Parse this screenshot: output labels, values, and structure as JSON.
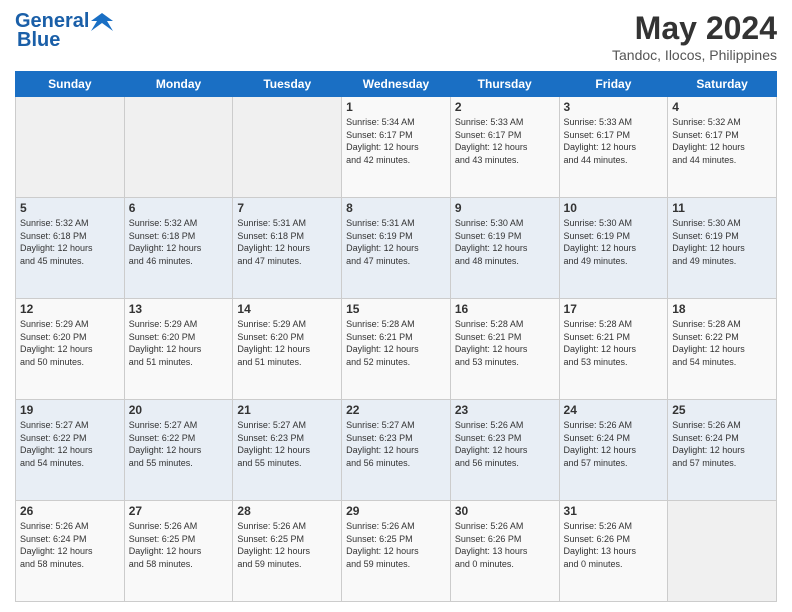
{
  "header": {
    "logo_line1": "General",
    "logo_line2": "Blue",
    "month_year": "May 2024",
    "location": "Tandoc, Ilocos, Philippines"
  },
  "days_of_week": [
    "Sunday",
    "Monday",
    "Tuesday",
    "Wednesday",
    "Thursday",
    "Friday",
    "Saturday"
  ],
  "weeks": [
    [
      {
        "day": "",
        "info": ""
      },
      {
        "day": "",
        "info": ""
      },
      {
        "day": "",
        "info": ""
      },
      {
        "day": "1",
        "info": "Sunrise: 5:34 AM\nSunset: 6:17 PM\nDaylight: 12 hours\nand 42 minutes."
      },
      {
        "day": "2",
        "info": "Sunrise: 5:33 AM\nSunset: 6:17 PM\nDaylight: 12 hours\nand 43 minutes."
      },
      {
        "day": "3",
        "info": "Sunrise: 5:33 AM\nSunset: 6:17 PM\nDaylight: 12 hours\nand 44 minutes."
      },
      {
        "day": "4",
        "info": "Sunrise: 5:32 AM\nSunset: 6:17 PM\nDaylight: 12 hours\nand 44 minutes."
      }
    ],
    [
      {
        "day": "5",
        "info": "Sunrise: 5:32 AM\nSunset: 6:18 PM\nDaylight: 12 hours\nand 45 minutes."
      },
      {
        "day": "6",
        "info": "Sunrise: 5:32 AM\nSunset: 6:18 PM\nDaylight: 12 hours\nand 46 minutes."
      },
      {
        "day": "7",
        "info": "Sunrise: 5:31 AM\nSunset: 6:18 PM\nDaylight: 12 hours\nand 47 minutes."
      },
      {
        "day": "8",
        "info": "Sunrise: 5:31 AM\nSunset: 6:19 PM\nDaylight: 12 hours\nand 47 minutes."
      },
      {
        "day": "9",
        "info": "Sunrise: 5:30 AM\nSunset: 6:19 PM\nDaylight: 12 hours\nand 48 minutes."
      },
      {
        "day": "10",
        "info": "Sunrise: 5:30 AM\nSunset: 6:19 PM\nDaylight: 12 hours\nand 49 minutes."
      },
      {
        "day": "11",
        "info": "Sunrise: 5:30 AM\nSunset: 6:19 PM\nDaylight: 12 hours\nand 49 minutes."
      }
    ],
    [
      {
        "day": "12",
        "info": "Sunrise: 5:29 AM\nSunset: 6:20 PM\nDaylight: 12 hours\nand 50 minutes."
      },
      {
        "day": "13",
        "info": "Sunrise: 5:29 AM\nSunset: 6:20 PM\nDaylight: 12 hours\nand 51 minutes."
      },
      {
        "day": "14",
        "info": "Sunrise: 5:29 AM\nSunset: 6:20 PM\nDaylight: 12 hours\nand 51 minutes."
      },
      {
        "day": "15",
        "info": "Sunrise: 5:28 AM\nSunset: 6:21 PM\nDaylight: 12 hours\nand 52 minutes."
      },
      {
        "day": "16",
        "info": "Sunrise: 5:28 AM\nSunset: 6:21 PM\nDaylight: 12 hours\nand 53 minutes."
      },
      {
        "day": "17",
        "info": "Sunrise: 5:28 AM\nSunset: 6:21 PM\nDaylight: 12 hours\nand 53 minutes."
      },
      {
        "day": "18",
        "info": "Sunrise: 5:28 AM\nSunset: 6:22 PM\nDaylight: 12 hours\nand 54 minutes."
      }
    ],
    [
      {
        "day": "19",
        "info": "Sunrise: 5:27 AM\nSunset: 6:22 PM\nDaylight: 12 hours\nand 54 minutes."
      },
      {
        "day": "20",
        "info": "Sunrise: 5:27 AM\nSunset: 6:22 PM\nDaylight: 12 hours\nand 55 minutes."
      },
      {
        "day": "21",
        "info": "Sunrise: 5:27 AM\nSunset: 6:23 PM\nDaylight: 12 hours\nand 55 minutes."
      },
      {
        "day": "22",
        "info": "Sunrise: 5:27 AM\nSunset: 6:23 PM\nDaylight: 12 hours\nand 56 minutes."
      },
      {
        "day": "23",
        "info": "Sunrise: 5:26 AM\nSunset: 6:23 PM\nDaylight: 12 hours\nand 56 minutes."
      },
      {
        "day": "24",
        "info": "Sunrise: 5:26 AM\nSunset: 6:24 PM\nDaylight: 12 hours\nand 57 minutes."
      },
      {
        "day": "25",
        "info": "Sunrise: 5:26 AM\nSunset: 6:24 PM\nDaylight: 12 hours\nand 57 minutes."
      }
    ],
    [
      {
        "day": "26",
        "info": "Sunrise: 5:26 AM\nSunset: 6:24 PM\nDaylight: 12 hours\nand 58 minutes."
      },
      {
        "day": "27",
        "info": "Sunrise: 5:26 AM\nSunset: 6:25 PM\nDaylight: 12 hours\nand 58 minutes."
      },
      {
        "day": "28",
        "info": "Sunrise: 5:26 AM\nSunset: 6:25 PM\nDaylight: 12 hours\nand 59 minutes."
      },
      {
        "day": "29",
        "info": "Sunrise: 5:26 AM\nSunset: 6:25 PM\nDaylight: 12 hours\nand 59 minutes."
      },
      {
        "day": "30",
        "info": "Sunrise: 5:26 AM\nSunset: 6:26 PM\nDaylight: 13 hours\nand 0 minutes."
      },
      {
        "day": "31",
        "info": "Sunrise: 5:26 AM\nSunset: 6:26 PM\nDaylight: 13 hours\nand 0 minutes."
      },
      {
        "day": "",
        "info": ""
      }
    ]
  ]
}
